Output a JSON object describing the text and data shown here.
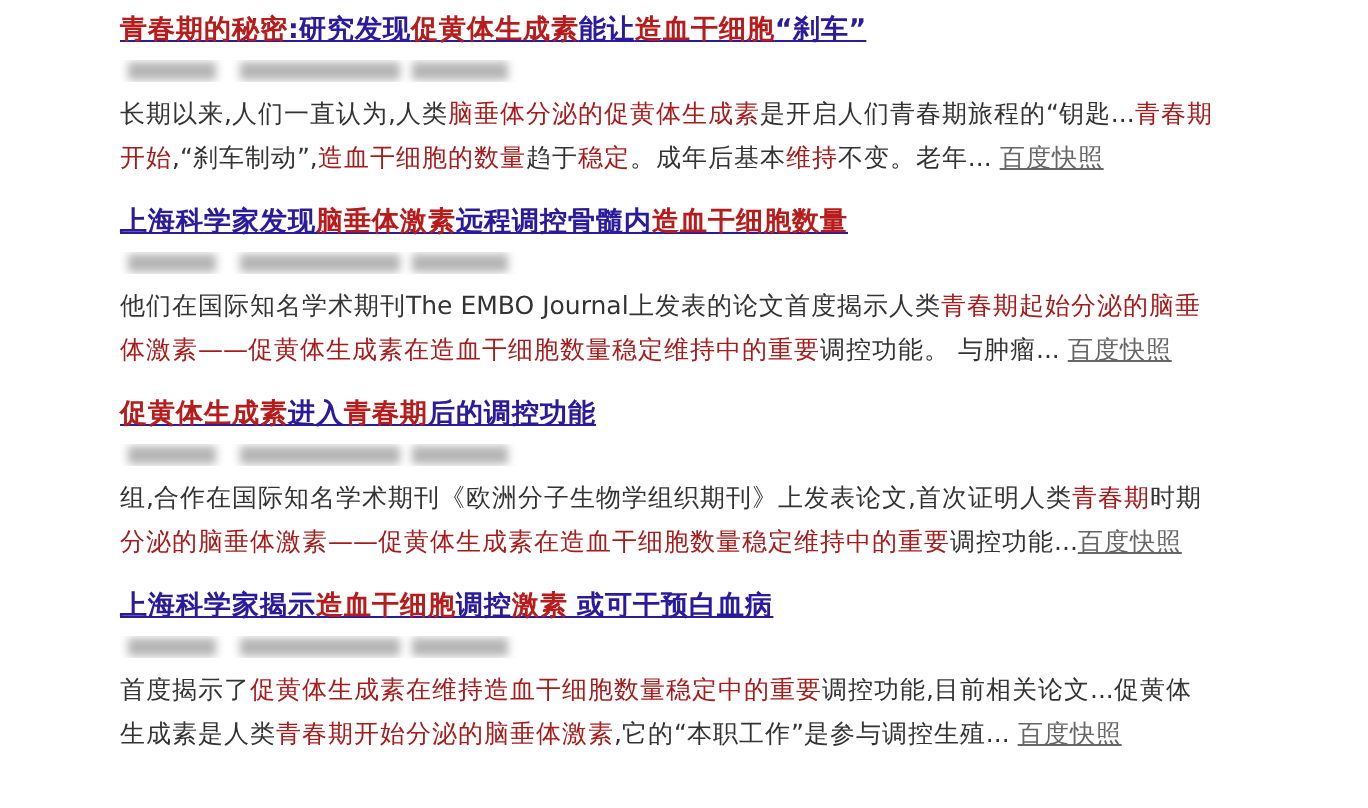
{
  "results": [
    {
      "title": [
        {
          "text": "青春期的秘密",
          "highlight": true
        },
        {
          "text": ":研究发现",
          "highlight": false
        },
        {
          "text": "促黄体生成素",
          "highlight": true
        },
        {
          "text": "能让",
          "highlight": false
        },
        {
          "text": "造血干细胞",
          "highlight": true
        },
        {
          "text": "“刹车”",
          "highlight": false
        }
      ],
      "snippet": [
        {
          "text": "长期以来,人们一直认为,人类",
          "highlight": false
        },
        {
          "text": "脑垂体分泌的促黄体生成素",
          "highlight": true
        },
        {
          "text": "是开启人们青春期旅程的“钥匙...",
          "highlight": false
        },
        {
          "text": "青春期开始",
          "highlight": true
        },
        {
          "text": ",“刹车制动”,",
          "highlight": false
        },
        {
          "text": "造血干细胞的数量",
          "highlight": true
        },
        {
          "text": "趋于",
          "highlight": false
        },
        {
          "text": "稳定",
          "highlight": true
        },
        {
          "text": "。成年后基本",
          "highlight": false
        },
        {
          "text": "维持",
          "highlight": true
        },
        {
          "text": "不变。老年... ",
          "highlight": false
        }
      ],
      "snapshot": "百度快照"
    },
    {
      "title": [
        {
          "text": "上海科学家发现",
          "highlight": false
        },
        {
          "text": "脑垂体激素",
          "highlight": true
        },
        {
          "text": "远程调控骨髓内",
          "highlight": false
        },
        {
          "text": "造血干细胞数量",
          "highlight": true
        }
      ],
      "snippet": [
        {
          "text": "他们在国际知名学术期刊The EMBO Journal上发表的论文首度揭示人类",
          "highlight": false
        },
        {
          "text": "青春期起始分泌的脑垂体激素——促黄体生成素在造血干细胞数量稳定维持中的重要",
          "highlight": true
        },
        {
          "text": "调控功能。 与肿瘤... ",
          "highlight": false
        }
      ],
      "snapshot": "百度快照"
    },
    {
      "title": [
        {
          "text": "促黄体生成素",
          "highlight": true
        },
        {
          "text": "进入",
          "highlight": false
        },
        {
          "text": "青春期",
          "highlight": true
        },
        {
          "text": "后的调控功能",
          "highlight": false
        }
      ],
      "snippet": [
        {
          "text": "组,合作在国际知名学术期刊《欧洲分子生物学组织期刊》上发表论文,首次证明人类",
          "highlight": false
        },
        {
          "text": "青春期",
          "highlight": true
        },
        {
          "text": "时期",
          "highlight": false
        },
        {
          "text": "分泌的脑垂体激素——促黄体生成素在造血干细胞数量稳定维持中的重要",
          "highlight": true
        },
        {
          "text": "调控功能...",
          "highlight": false
        }
      ],
      "snapshot": "百度快照"
    },
    {
      "title": [
        {
          "text": "上海科学家揭示",
          "highlight": false
        },
        {
          "text": "造血干细胞",
          "highlight": true
        },
        {
          "text": "调控",
          "highlight": false
        },
        {
          "text": "激素",
          "highlight": true
        },
        {
          "text": " 或可干预白血病",
          "highlight": false
        }
      ],
      "snippet": [
        {
          "text": "首度揭示了",
          "highlight": false
        },
        {
          "text": "促黄体生成素在维持造血干细胞数量稳定中的重要",
          "highlight": true
        },
        {
          "text": "调控功能,目前相关论文...促黄体生成素是人类",
          "highlight": false
        },
        {
          "text": "青春期开始分泌的脑垂体激素",
          "highlight": true
        },
        {
          "text": ",它的“本职工作”是参与调控生殖... ",
          "highlight": false
        }
      ],
      "snapshot": "百度快照"
    }
  ]
}
